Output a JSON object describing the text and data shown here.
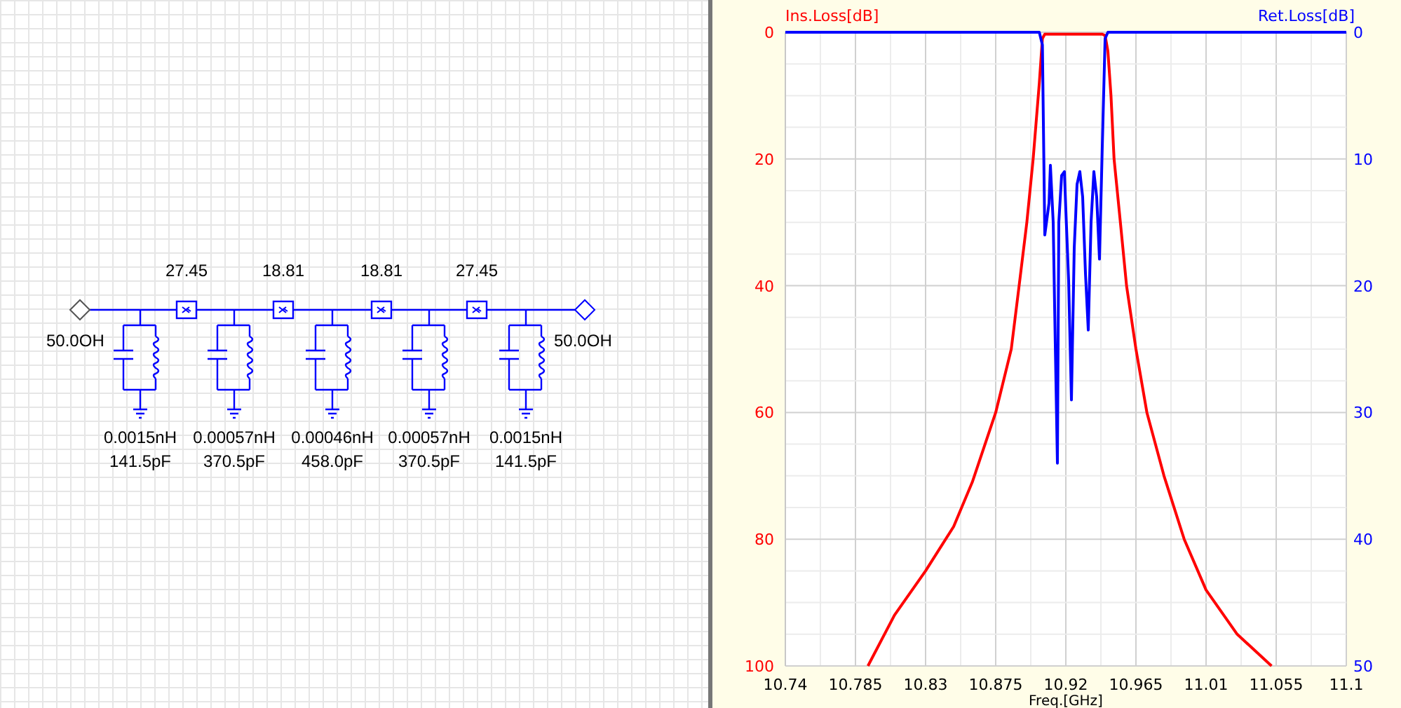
{
  "schematic": {
    "ports": [
      {
        "label": "50.0OH"
      },
      {
        "label": "50.0OH"
      }
    ],
    "couplers": [
      {
        "value": "27.45"
      },
      {
        "value": "18.81"
      },
      {
        "value": "18.81"
      },
      {
        "value": "27.45"
      }
    ],
    "resonators": [
      {
        "inductance": "0.0015nH",
        "capacitance": "141.5pF"
      },
      {
        "inductance": "0.00057nH",
        "capacitance": "370.5pF"
      },
      {
        "inductance": "0.00046nH",
        "capacitance": "458.0pF"
      },
      {
        "inductance": "0.00057nH",
        "capacitance": "370.5pF"
      },
      {
        "inductance": "0.0015nH",
        "capacitance": "141.5pF"
      }
    ]
  },
  "plot": {
    "chart_data": {
      "type": "line",
      "xlabel": "Freq.[GHz]",
      "ylabel": "Ins.Loss[dB]",
      "y2label": "Ret.Loss[dB]",
      "x": [
        10.74,
        10.785,
        10.793,
        10.81,
        10.83,
        10.848,
        10.86,
        10.875,
        10.885,
        10.89,
        10.895,
        10.899,
        10.903,
        10.905,
        10.9065,
        10.9092,
        10.9101,
        10.9119,
        10.9128,
        10.9146,
        10.9155,
        10.9173,
        10.9191,
        10.92,
        10.9218,
        10.9236,
        10.9254,
        10.9272,
        10.929,
        10.9308,
        10.9326,
        10.9344,
        10.9362,
        10.938,
        10.9398,
        10.9416,
        10.9434,
        10.9452,
        10.947,
        10.949,
        10.951,
        10.955,
        10.959,
        10.965,
        10.972,
        10.983,
        10.996,
        11.01,
        11.03,
        11.052,
        11.055,
        11.1
      ],
      "series": [
        {
          "color": "#ff0000",
          "values": [
            null,
            null,
            100,
            92,
            85,
            78,
            71,
            60,
            50,
            40,
            30,
            20,
            8,
            1,
            0.3,
            0.3,
            0.3,
            0.3,
            0.3,
            0.3,
            0.3,
            0.3,
            0.3,
            0.3,
            0.3,
            0.3,
            0.3,
            0.3,
            0.3,
            0.3,
            0.3,
            0.3,
            0.3,
            0.3,
            0.3,
            0.3,
            0.3,
            0.5,
            3,
            10,
            20,
            30,
            40,
            50,
            60,
            70,
            80,
            88,
            95,
            100,
            null,
            null
          ]
        },
        {
          "color": "#0000ff",
          "axis": "y2",
          "values": [
            0,
            0,
            0,
            0,
            0,
            0,
            0,
            0,
            0,
            0,
            0,
            0,
            0,
            1,
            16,
            13.5,
            10.5,
            15,
            21.6,
            34,
            15,
            11.3,
            11,
            14,
            19.6,
            29,
            17,
            12,
            11,
            13,
            19,
            23.5,
            15,
            11,
            13,
            17.9,
            9,
            0.5,
            0,
            0,
            0,
            0,
            0,
            0,
            0,
            0,
            0,
            0,
            0,
            0,
            0,
            0
          ]
        }
      ],
      "xlim": [
        10.74,
        11.1
      ],
      "ylim": [
        100,
        0
      ],
      "y2lim": [
        50,
        0
      ],
      "grid": true,
      "xticks": [
        10.74,
        10.785,
        10.83,
        10.875,
        10.92,
        10.965,
        11.01,
        11.055,
        11.1
      ],
      "yticks": [
        0,
        20,
        40,
        60,
        80,
        100
      ],
      "y2ticks": [
        0,
        10,
        20,
        30,
        40,
        50
      ]
    }
  }
}
